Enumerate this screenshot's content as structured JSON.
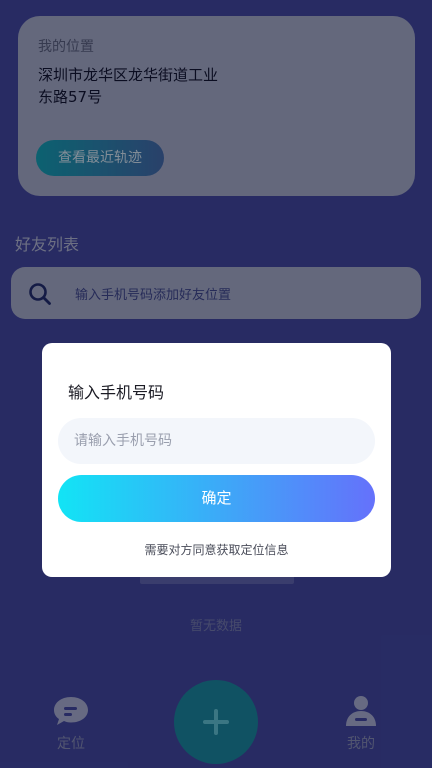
{
  "location_card": {
    "label": "我的位置",
    "address_line1": "深圳市龙华区龙华街道工业",
    "address_line2": "东路57号",
    "track_button_label": "查看最近轨迹"
  },
  "friends": {
    "title": "好友列表",
    "search_placeholder": "输入手机号码添加好友位置",
    "empty_text": "暂无数据"
  },
  "nav": {
    "location_label": "定位",
    "mine_label": "我的",
    "add_icon": "plus-icon"
  },
  "dialog": {
    "title": "输入手机号码",
    "input_placeholder": "请输入手机号码",
    "input_value": "",
    "confirm_label": "确定",
    "note": "需要对方同意获取定位信息"
  },
  "colors": {
    "background": "#3e4399",
    "accent_gradient_start": "#12e4f5",
    "accent_gradient_end": "#6571fb"
  }
}
